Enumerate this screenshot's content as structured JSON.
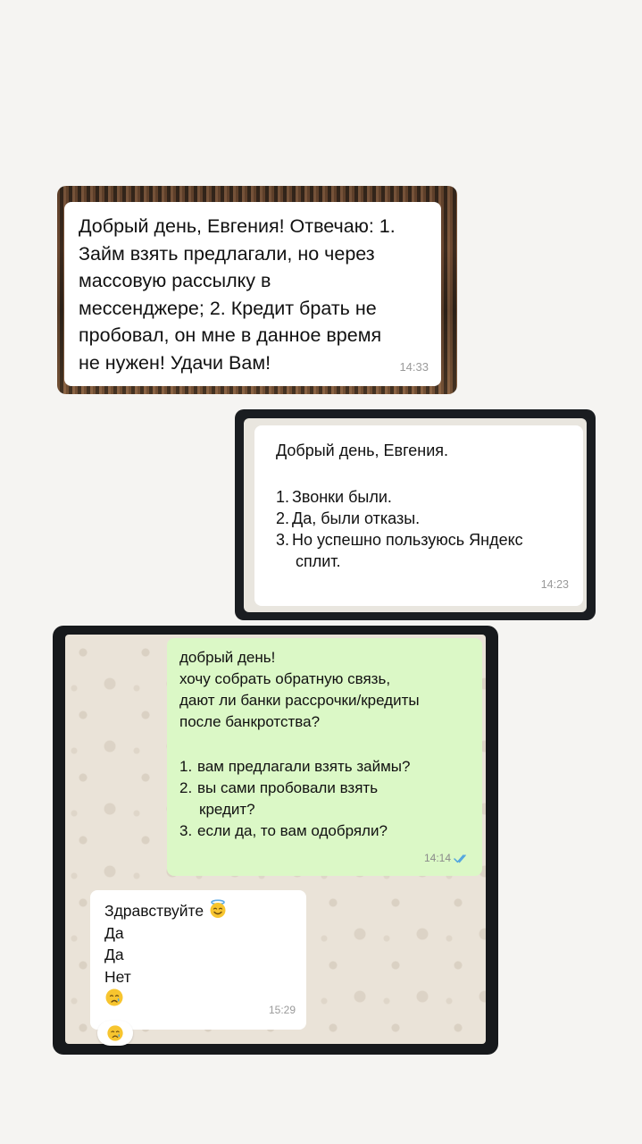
{
  "screenshot1": {
    "lines": [
      "Добрый день, Евгения! Отвечаю: 1.",
      "Займ взять предлагали, но через",
      "массовую рассылку в",
      "мессенджере; 2. Кредит брать не",
      "пробовал, он мне в данное время",
      "не нужен!  Удачи Вам!"
    ],
    "time": "14:33"
  },
  "screenshot2": {
    "greeting": "Добрый день, Евгения.",
    "items": [
      {
        "num": "1.",
        "text": "Звонки были."
      },
      {
        "num": "2.",
        "text": "Да, были отказы."
      },
      {
        "num": "3.",
        "text": "Но успешно пользуюсь Яндекс",
        "cont": "сплит."
      }
    ],
    "time": "14:23"
  },
  "screenshot3": {
    "outgoing": {
      "lines": [
        "добрый день!",
        "хочу собрать обратную связь,",
        "дают ли банки рассрочки/кредиты",
        "после банкротства?"
      ],
      "items": [
        {
          "num": "1.",
          "text": "вам предлагали взять займы?"
        },
        {
          "num": "2.",
          "text": "вы сами пробовали взять",
          "cont": "кредит?"
        },
        {
          "num": "3.",
          "text": "если да, то вам одобряли?"
        }
      ],
      "time": "14:14",
      "status_icon": "double-check-read-icon",
      "status_color": "#4fa3e0"
    },
    "incoming": {
      "line1": "Здравствуйте",
      "line1_emoji": "smiling-face-with-halo-icon",
      "line2": "Да",
      "line3": "Да",
      "line4": "Нет",
      "line5_emoji": "crying-face-icon",
      "time": "15:29"
    },
    "reaction_emoji": "crying-face-icon"
  }
}
